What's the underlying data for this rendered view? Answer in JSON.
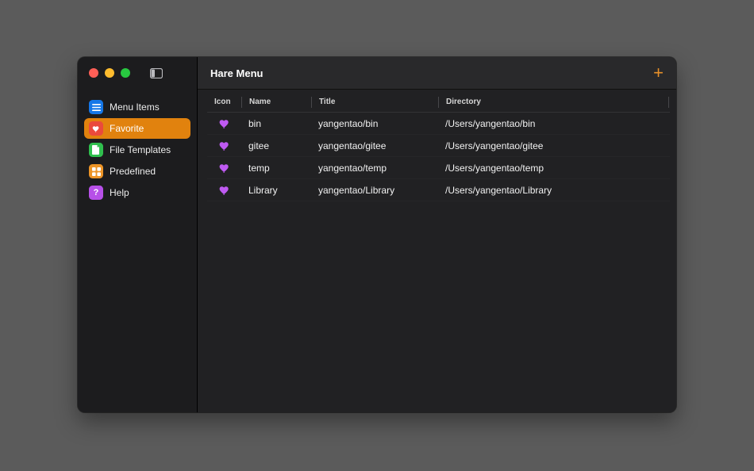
{
  "window": {
    "title": "Hare Menu",
    "add_label": "+"
  },
  "colors": {
    "accent_orange": "#e1820e",
    "plus_orange": "#e8912a",
    "heart_purple": "#bf5af2",
    "traffic_red": "#ff5f57",
    "traffic_yellow": "#febc2e",
    "traffic_green": "#28c840",
    "sidebar_bg": "#1c1c1e",
    "content_bg": "#212123"
  },
  "sidebar": {
    "items": [
      {
        "label": "Menu Items",
        "icon": "list-icon",
        "color": "#1577e8",
        "selected": false
      },
      {
        "label": "Favorite",
        "icon": "heart-icon",
        "color": "#ea4a3c",
        "selected": true
      },
      {
        "label": "File Templates",
        "icon": "file-icon",
        "color": "#30bf4e",
        "selected": false
      },
      {
        "label": "Predefined",
        "icon": "grid-icon",
        "color": "#ec9427",
        "selected": false
      },
      {
        "label": "Help",
        "icon": "question-icon",
        "color": "#b750e8",
        "selected": false
      }
    ]
  },
  "table": {
    "columns": [
      "Icon",
      "Name",
      "Title",
      "Directory"
    ],
    "rows": [
      {
        "icon": "heart-icon",
        "name": "bin",
        "title": "yangentao/bin",
        "directory": "/Users/yangentao/bin"
      },
      {
        "icon": "heart-icon",
        "name": "gitee",
        "title": "yangentao/gitee",
        "directory": "/Users/yangentao/gitee"
      },
      {
        "icon": "heart-icon",
        "name": "temp",
        "title": "yangentao/temp",
        "directory": "/Users/yangentao/temp"
      },
      {
        "icon": "heart-icon",
        "name": "Library",
        "title": "yangentao/Library",
        "directory": "/Users/yangentao/Library"
      }
    ]
  }
}
